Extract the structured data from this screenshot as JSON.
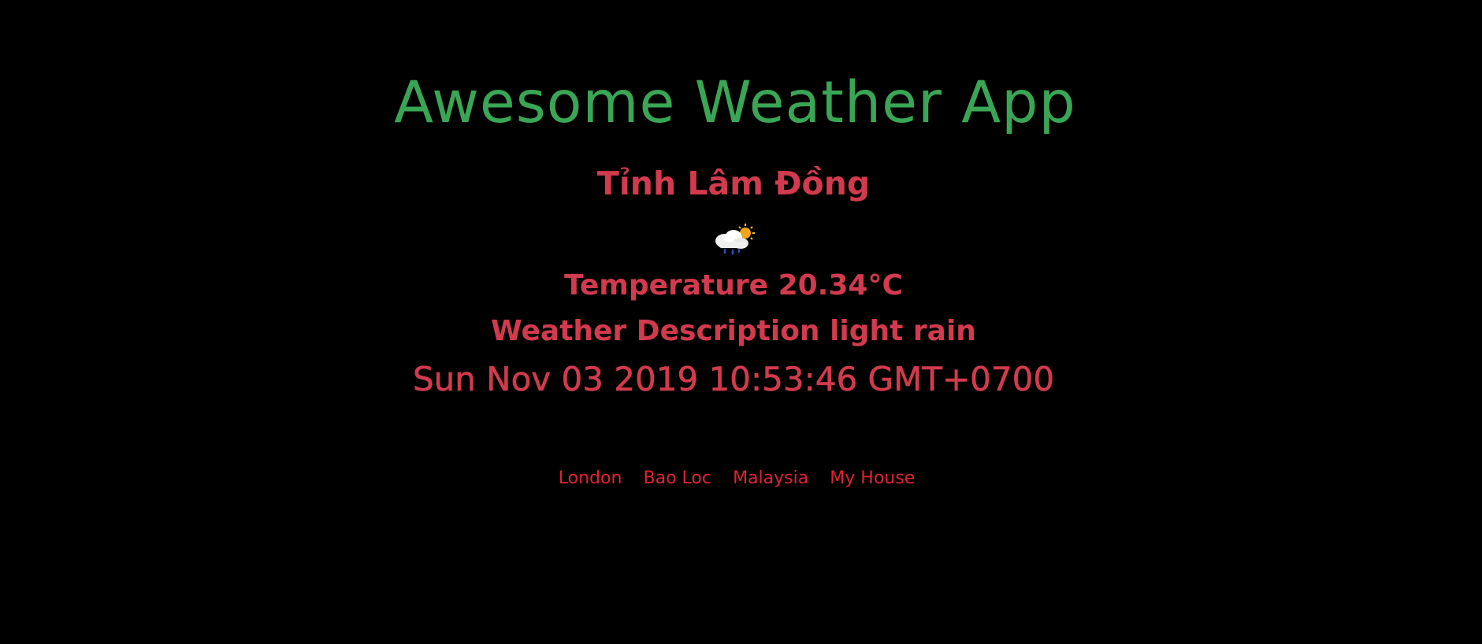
{
  "app": {
    "title": "Awesome Weather App"
  },
  "weather": {
    "location": "Tỉnh Lâm Đồng",
    "icon": "cloud-rain-sun-icon",
    "temperature_text": "Temperature 20.34°C",
    "description_text": "Weather Description light rain",
    "datetime": "Sun Nov 03 2019 10:53:46 GMT+0700"
  },
  "nav": {
    "links": [
      {
        "label": "London"
      },
      {
        "label": "Bao Loc"
      },
      {
        "label": "Malaysia"
      },
      {
        "label": "My House"
      }
    ]
  },
  "colors": {
    "background": "#000000",
    "title": "#3aa655",
    "text": "#d23a4d",
    "link": "#e02233"
  }
}
